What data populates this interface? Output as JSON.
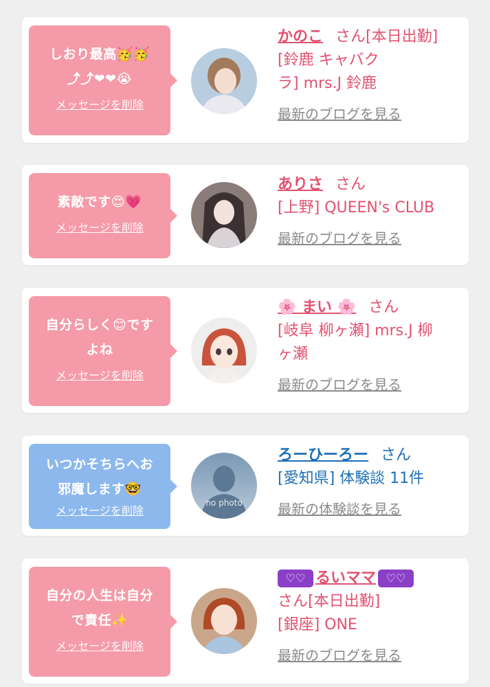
{
  "cards": [
    {
      "bubble_color": "pink",
      "message_line1": "しおり最高🥳🥳",
      "message_line2": "⤴⤴❤❤😭",
      "delete_label": "メッセージを削除",
      "name": "かのこ",
      "suffix": "さん[本日出勤]",
      "detail_line1": "[鈴鹿 キャバク",
      "detail_line2": "ラ] mrs.J 鈴鹿",
      "link_label": "最新のブログを見る",
      "avatar_icon": "user-photo-icon"
    },
    {
      "bubble_color": "pink",
      "message_line1": "素敵です😍💗",
      "delete_label": "メッセージを削除",
      "name": "ありさ",
      "suffix": "さん",
      "detail_line1": "[上野] QUEEN's CLUB",
      "link_label": "最新のブログを見る",
      "avatar_icon": "user-photo-icon"
    },
    {
      "bubble_color": "pink",
      "message_line1": "自分らしく😊です",
      "message_line2": "よね",
      "delete_label": "メッセージを削除",
      "name": "🌸 まい 🌸",
      "suffix": "さん",
      "detail_line1": "[岐阜 柳ヶ瀬] mrs.J 柳",
      "detail_line2": "ヶ瀬",
      "link_label": "最新のブログを見る",
      "avatar_icon": "user-photo-icon"
    },
    {
      "bubble_color": "blue",
      "message_line1": "いつかそちらへお",
      "message_line2": "邪魔します🤓",
      "delete_label": "メッセージを削除",
      "name": "ろーひーろー",
      "suffix": "さん",
      "detail_line1": "[愛知県] 体験談 11件",
      "link_label": "最新の体験談を見る",
      "avatar_icon": "no-photo-icon",
      "avatar_text": "no photo"
    },
    {
      "bubble_color": "pink",
      "message_line1": "自分の人生は自分",
      "message_line2": "で責任✨",
      "delete_label": "メッセージを削除",
      "name_prefix": "♡♡",
      "name": "るいママ",
      "name_suffix": "♡♡",
      "suffix": "さん[本日出勤]",
      "detail_line1": "[銀座] ONE",
      "link_label": "最新のブログを見る",
      "avatar_icon": "user-photo-icon"
    }
  ],
  "colors": {
    "pink_bubble": "#f59aa8",
    "blue_bubble": "#8db8ee",
    "pink_text": "#e2516f",
    "blue_text": "#1d6fb6",
    "link_gray": "#8a8a8a"
  }
}
